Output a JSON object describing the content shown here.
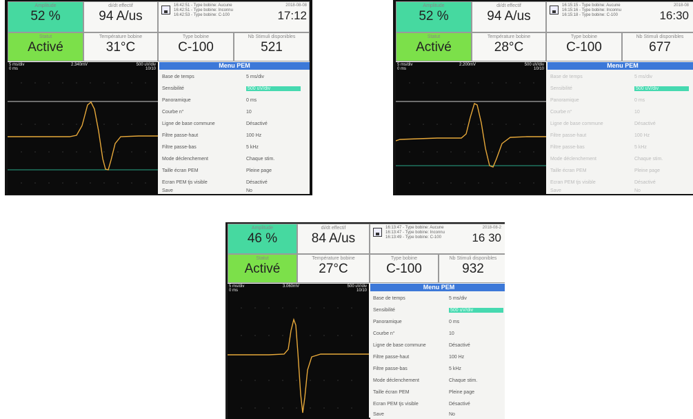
{
  "panels": [
    {
      "amplitude": {
        "label": "Amplitude",
        "value": "52 %"
      },
      "didt": {
        "label": "di/dt effectif",
        "value": "94 A/us"
      },
      "log": [
        "16:42:51 - Type bobine: Aucune",
        "16:42:51 - Type bobine: Inconnu",
        "16:42:53 - Type bobine: C-100"
      ],
      "date": "2018-08-08",
      "time": "17:12",
      "statut": {
        "label": "Statut",
        "value": "Activé"
      },
      "temperature": {
        "label": "Température bobine",
        "value": "31°C"
      },
      "type_bobine": {
        "label": "Type bobine",
        "value": "C-100"
      },
      "stimuli": {
        "label": "Nb Stimuli disponibles",
        "value": "521"
      },
      "scope": {
        "timebase": "5 ms/div",
        "offset": "0 ms",
        "peak": "2.340mV",
        "sens": "500 uV/div",
        "count": "10/10"
      },
      "menu_title": "Menu PEM",
      "menu": [
        {
          "key": "Base de temps",
          "value": "5 ms/div"
        },
        {
          "key": "Sensibilité",
          "value": "500 uV/div",
          "selected": true
        },
        {
          "key": "Panoramique",
          "value": "0 ms"
        },
        {
          "key": "Courbe n°",
          "value": "10"
        },
        {
          "key": "Ligne de base commune",
          "value": "Désactivé"
        },
        {
          "key": "Filtre passe-haut",
          "value": "100 Hz"
        },
        {
          "key": "Filtre passe-bas",
          "value": "5 kHz"
        },
        {
          "key": "Mode déclenchement",
          "value": "Chaque stim."
        },
        {
          "key": "Taille écran PEM",
          "value": "Pleine page"
        },
        {
          "key": "Ecran PEM tjs visible",
          "value": "Désactivé"
        },
        {
          "key": "Save",
          "value": "No"
        }
      ]
    },
    {
      "amplitude": {
        "label": "Amplitude",
        "value": "52 %"
      },
      "didt": {
        "label": "di/dt effectif",
        "value": "94 A/us"
      },
      "log": [
        "16:15:15 - Type bobine: Aucune",
        "16:15:16 - Type bobine: Inconnu",
        "16:15:18 - Type bobine: C-100"
      ],
      "date": "2018-08",
      "time": "16:30",
      "statut": {
        "label": "Statut",
        "value": "Activé"
      },
      "temperature": {
        "label": "Température bobine",
        "value": "28°C"
      },
      "type_bobine": {
        "label": "Type bobine",
        "value": "C-100"
      },
      "stimuli": {
        "label": "Nb Stimuli disponibles",
        "value": "677"
      },
      "scope": {
        "timebase": "5 ms/div",
        "offset": "0 ms",
        "peak": "2.200mV",
        "sens": "500 uV/div",
        "count": "10/10"
      },
      "menu_title": "Menu PEM",
      "menu": [
        {
          "key": "Base de temps",
          "value": "5 ms/div"
        },
        {
          "key": "Sensibilité",
          "value": "500 uV/div",
          "selected": true
        },
        {
          "key": "Panoramique",
          "value": "0 ms"
        },
        {
          "key": "Courbe n°",
          "value": "10"
        },
        {
          "key": "Ligne de base commune",
          "value": "Désactivé"
        },
        {
          "key": "Filtre passe-haut",
          "value": "100 Hz"
        },
        {
          "key": "Filtre passe-bas",
          "value": "5 kHz"
        },
        {
          "key": "Mode déclenchement",
          "value": "Chaque stim."
        },
        {
          "key": "Taille écran PEM",
          "value": "Pleine page"
        },
        {
          "key": "Ecran PEM tjs visible",
          "value": "Désactivé"
        },
        {
          "key": "Save",
          "value": "No"
        }
      ]
    },
    {
      "amplitude": {
        "label": "Amplitude",
        "value": "46 %"
      },
      "didt": {
        "label": "di/dt effectif",
        "value": "84 A/us"
      },
      "log": [
        "16:13:47 - Type bobine: Aucune",
        "16:13:47 - Type bobine: Inconnu",
        "16:13:49 - Type bobine: C-100"
      ],
      "date": "2018-08-2",
      "time": "16 30",
      "statut": {
        "label": "Statut",
        "value": "Activé"
      },
      "temperature": {
        "label": "Température bobine",
        "value": "27°C"
      },
      "type_bobine": {
        "label": "Type bobine",
        "value": "C-100"
      },
      "stimuli": {
        "label": "Nb Stimuli disponibles",
        "value": "932"
      },
      "scope": {
        "timebase": "5 ms/div",
        "offset": "0 ms",
        "peak": "3.060mV",
        "sens": "500 uV/div",
        "count": "10/10"
      },
      "menu_title": "Menu PEM",
      "menu": [
        {
          "key": "Base de temps",
          "value": "5 ms/div"
        },
        {
          "key": "Sensibilité",
          "value": "500 uV/div",
          "selected": true
        },
        {
          "key": "Panoramique",
          "value": "0 ms"
        },
        {
          "key": "Courbe n°",
          "value": "10"
        },
        {
          "key": "Ligne de base commune",
          "value": "Désactivé"
        },
        {
          "key": "Filtre passe-haut",
          "value": "100 Hz"
        },
        {
          "key": "Filtre passe-bas",
          "value": "5 kHz"
        },
        {
          "key": "Mode déclenchement",
          "value": "Chaque stim."
        },
        {
          "key": "Taille écran PEM",
          "value": "Pleine page"
        },
        {
          "key": "Ecran PEM tjs visible",
          "value": "Désactivé"
        },
        {
          "key": "Save",
          "value": "No"
        }
      ]
    }
  ],
  "colors": {
    "amplitude_bg": "#46d9a0",
    "statut_bg": "#7ce04a",
    "menu_header": "#3c78d8",
    "trace": "#e8a93a",
    "baseline": "#2aa88a"
  }
}
